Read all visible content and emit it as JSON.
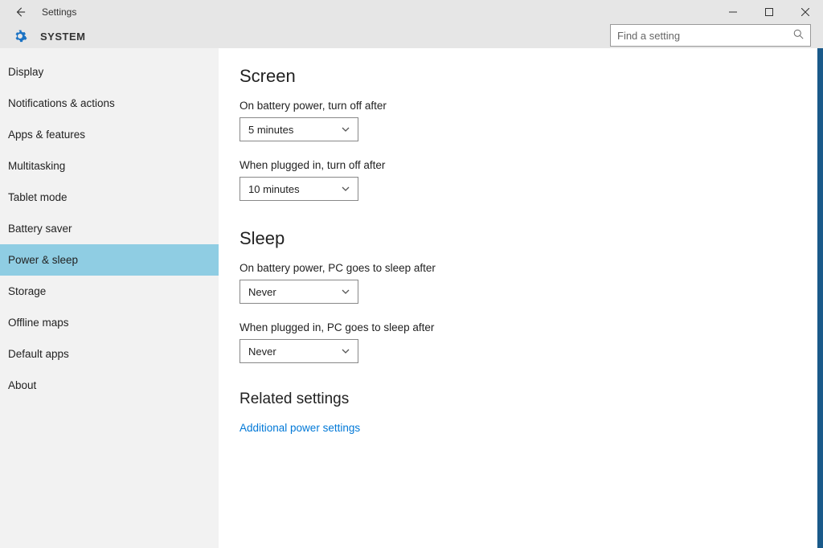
{
  "titlebar": {
    "title": "Settings"
  },
  "header": {
    "system_label": "SYSTEM",
    "search_placeholder": "Find a setting"
  },
  "sidebar": {
    "items": [
      {
        "label": "Display",
        "active": false
      },
      {
        "label": "Notifications & actions",
        "active": false
      },
      {
        "label": "Apps & features",
        "active": false
      },
      {
        "label": "Multitasking",
        "active": false
      },
      {
        "label": "Tablet mode",
        "active": false
      },
      {
        "label": "Battery saver",
        "active": false
      },
      {
        "label": "Power & sleep",
        "active": true
      },
      {
        "label": "Storage",
        "active": false
      },
      {
        "label": "Offline maps",
        "active": false
      },
      {
        "label": "Default apps",
        "active": false
      },
      {
        "label": "About",
        "active": false
      }
    ]
  },
  "content": {
    "screen": {
      "heading": "Screen",
      "battery_label": "On battery power, turn off after",
      "battery_value": "5 minutes",
      "plugged_label": "When plugged in, turn off after",
      "plugged_value": "10 minutes"
    },
    "sleep": {
      "heading": "Sleep",
      "battery_label": "On battery power, PC goes to sleep after",
      "battery_value": "Never",
      "plugged_label": "When plugged in, PC goes to sleep after",
      "plugged_value": "Never"
    },
    "related": {
      "heading": "Related settings",
      "link": "Additional power settings"
    }
  }
}
